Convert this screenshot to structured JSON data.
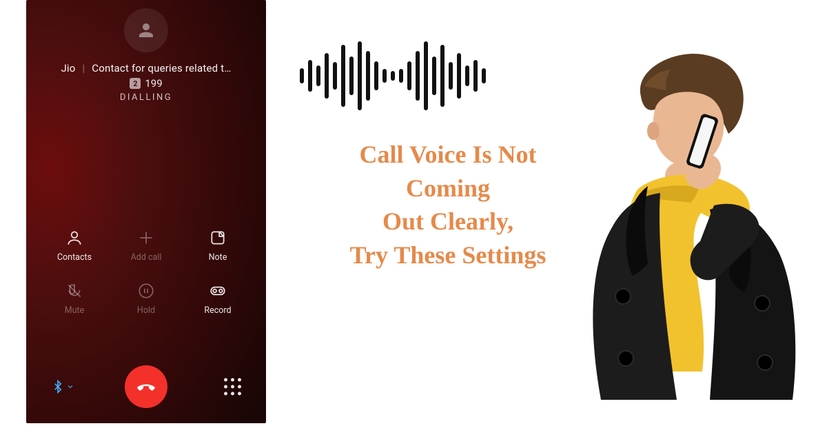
{
  "call": {
    "carrier": "Jio",
    "contact_line": "Contact for queries related t…",
    "sim_slot": "2",
    "number": "199",
    "status": "DIALLING",
    "actions": {
      "contacts": "Contacts",
      "add_call": "Add call",
      "note": "Note",
      "mute": "Mute",
      "hold": "Hold",
      "record": "Record"
    }
  },
  "headline": {
    "line1": "Call Voice Is Not",
    "line2": "Coming",
    "line3": "Out Clearly,",
    "line4": "Try These Settings"
  },
  "icons": {
    "avatar": "person-icon",
    "bluetooth": "bluetooth-icon",
    "dialpad": "dialpad-icon",
    "end_call": "end-call-icon",
    "waveform": "soundwave-icon",
    "man": "man-on-phone-illustration"
  }
}
